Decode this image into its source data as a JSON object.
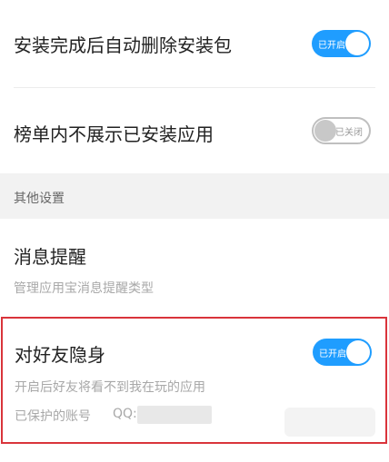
{
  "settings": {
    "auto_delete": {
      "title": "安装完成后自动删除安装包",
      "toggle_label": "已开启",
      "state": "on"
    },
    "hide_installed": {
      "title": "榜单内不展示已安装应用",
      "toggle_label": "已关闭",
      "state": "off"
    }
  },
  "other_section": {
    "header": "其他设置",
    "message_reminder": {
      "title": "消息提醒",
      "subtitle": "管理应用宝消息提醒类型"
    },
    "invisible_to_friends": {
      "title": "对好友隐身",
      "toggle_label": "已开启",
      "state": "on",
      "subtitle": "开启后好友将看不到我在玩的应用",
      "account_label": "已保护的账号",
      "qq_label": "QQ:"
    }
  },
  "colors": {
    "toggle_on": "#1f9dff",
    "toggle_off_border": "#bfbfbf",
    "highlight_border": "#d9343b",
    "section_bg": "#f2f2f2"
  }
}
